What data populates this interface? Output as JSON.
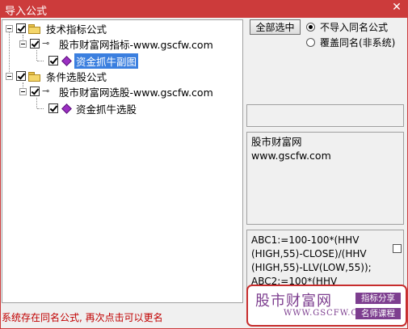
{
  "window": {
    "title": "导入公式",
    "close": "✕"
  },
  "tree": [
    {
      "label": "技术指标公式",
      "icon": "folder-icon",
      "checked": true
    },
    {
      "label": "股市财富网指标-www.gscfw.com",
      "icon": "key-icon",
      "checked": true
    },
    {
      "label": "资金抓牛副图",
      "icon": "formula-gem-icon",
      "checked": true,
      "selected": true
    },
    {
      "label": "条件选股公式",
      "icon": "folder-icon",
      "checked": true
    },
    {
      "label": "股市财富网选股-www.gscfw.com",
      "icon": "key-icon",
      "checked": true
    },
    {
      "label": "资金抓牛选股",
      "icon": "formula-gem-icon",
      "checked": true
    }
  ],
  "controls": {
    "select_all": "全部选中",
    "radio_no_import": "不导入同名公式",
    "radio_overwrite": "覆盖同名(非系统)",
    "selected_radio": "radio_no_import"
  },
  "info": {
    "line1": "股市财富网",
    "line2": "www.gscfw.com"
  },
  "code": {
    "text": "ABC1:=100-100*(HHV\n(HIGH,55)-CLOSE)/(HHV\n(HIGH,55)-LLV(LOW,55));\nABC2:=100*(HHV"
  },
  "brand": {
    "name": "股市财富网",
    "url": "WWW.GSCFW.COM",
    "tag1": "指标分享",
    "tag2": "名师课程",
    "color": "#7d3e8f",
    "border_color": "#c72d2d"
  },
  "status": "系统存在同名公式, 再次点击可以更名",
  "colors": {
    "titlebar": "#cc3b3b",
    "selection": "#3b7fdf",
    "status_text": "#c00000"
  }
}
